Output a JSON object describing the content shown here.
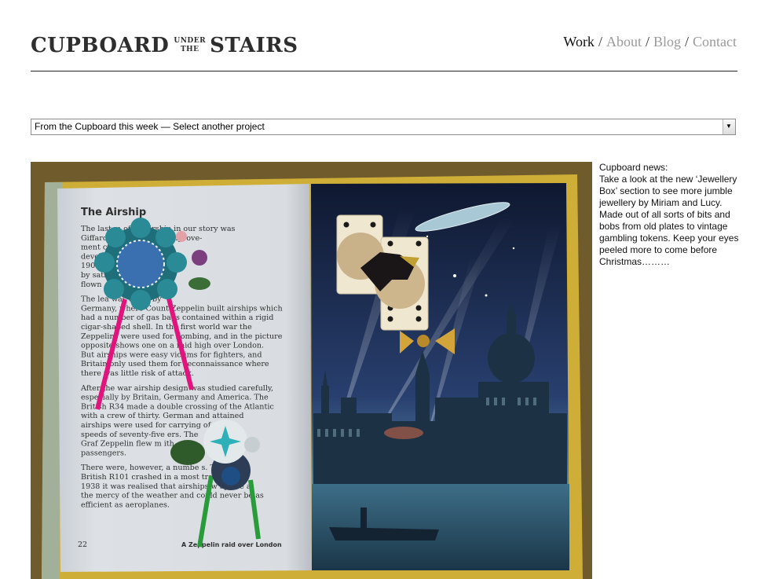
{
  "header": {
    "logo": {
      "left": "CUPBOARD",
      "under": "UNDER",
      "the": "THE",
      "right": "STAIRS"
    },
    "nav": [
      {
        "label": "Work"
      },
      {
        "label": "About"
      },
      {
        "label": "Blog"
      },
      {
        "label": "Contact"
      }
    ],
    "separator": "/"
  },
  "project_select": {
    "value": "From the Cupboard this week  —  Select another project"
  },
  "photo": {
    "book_title": "The Airship",
    "page_number": "22",
    "caption": "A Zeppelin raid over London",
    "text_lines": [
      "The last m      of an airship in our story was",
      "Giffard's        was but little improve-",
      "ment          ction engine was",
      "develo          w start, and in",
      "1901            modern airship",
      "by             sation by being",
      "flown",
      "",
      "The lea                    was taken by",
      "Germany, where Count Zeppelin built airships which",
      "had a number of gas bags contained within a rigid",
      "cigar-shaped shell.  In the first world war the",
      "Zeppelins were used for bombing, and in the picture",
      "opposite shows one on a raid high over London.",
      "But airships were easy victims for fighters, and",
      "Britain only used them for reconnaissance where",
      "there was little risk of attack.",
      "",
      "After the war airship design was studied carefully,",
      "especially by Britain, Germany and America.  The",
      "British R34 made a double crossing of the Atlantic",
      "with a crew of thirty.  German and          attained",
      "airships were used for carrying              of",
      "speeds of seventy-five                   ers.  The",
      "Graf Zeppelin flew m                 ith",
      "passengers.",
      "",
      "There were, however, a numbe         s.  The",
      "British R101 crashed in a most tra        er.  By",
      "1938 it was realised that airships w        ays be at",
      "the mercy of the weather and could never be as",
      "efficient as aeroplanes."
    ]
  },
  "news": {
    "heading": "Cupboard news:",
    "body": "Take a look at the new ‘Jewellery Box’ section to see more jumble jewellery by Miriam and Lucy. Made out of all sorts of bits and bobs from old plates to vintage gambling tokens. Keep your eyes peeled more to come before Christmas………"
  },
  "colors": {
    "text": "#2e2e2e",
    "nav_dim": "#9a9a9a",
    "rule": "#222222",
    "book_cover": "#d8b73a",
    "night_sky": "#1d2c52",
    "pink_ribbon": "#e0147c",
    "green_ribbon": "#2a9b3a"
  }
}
